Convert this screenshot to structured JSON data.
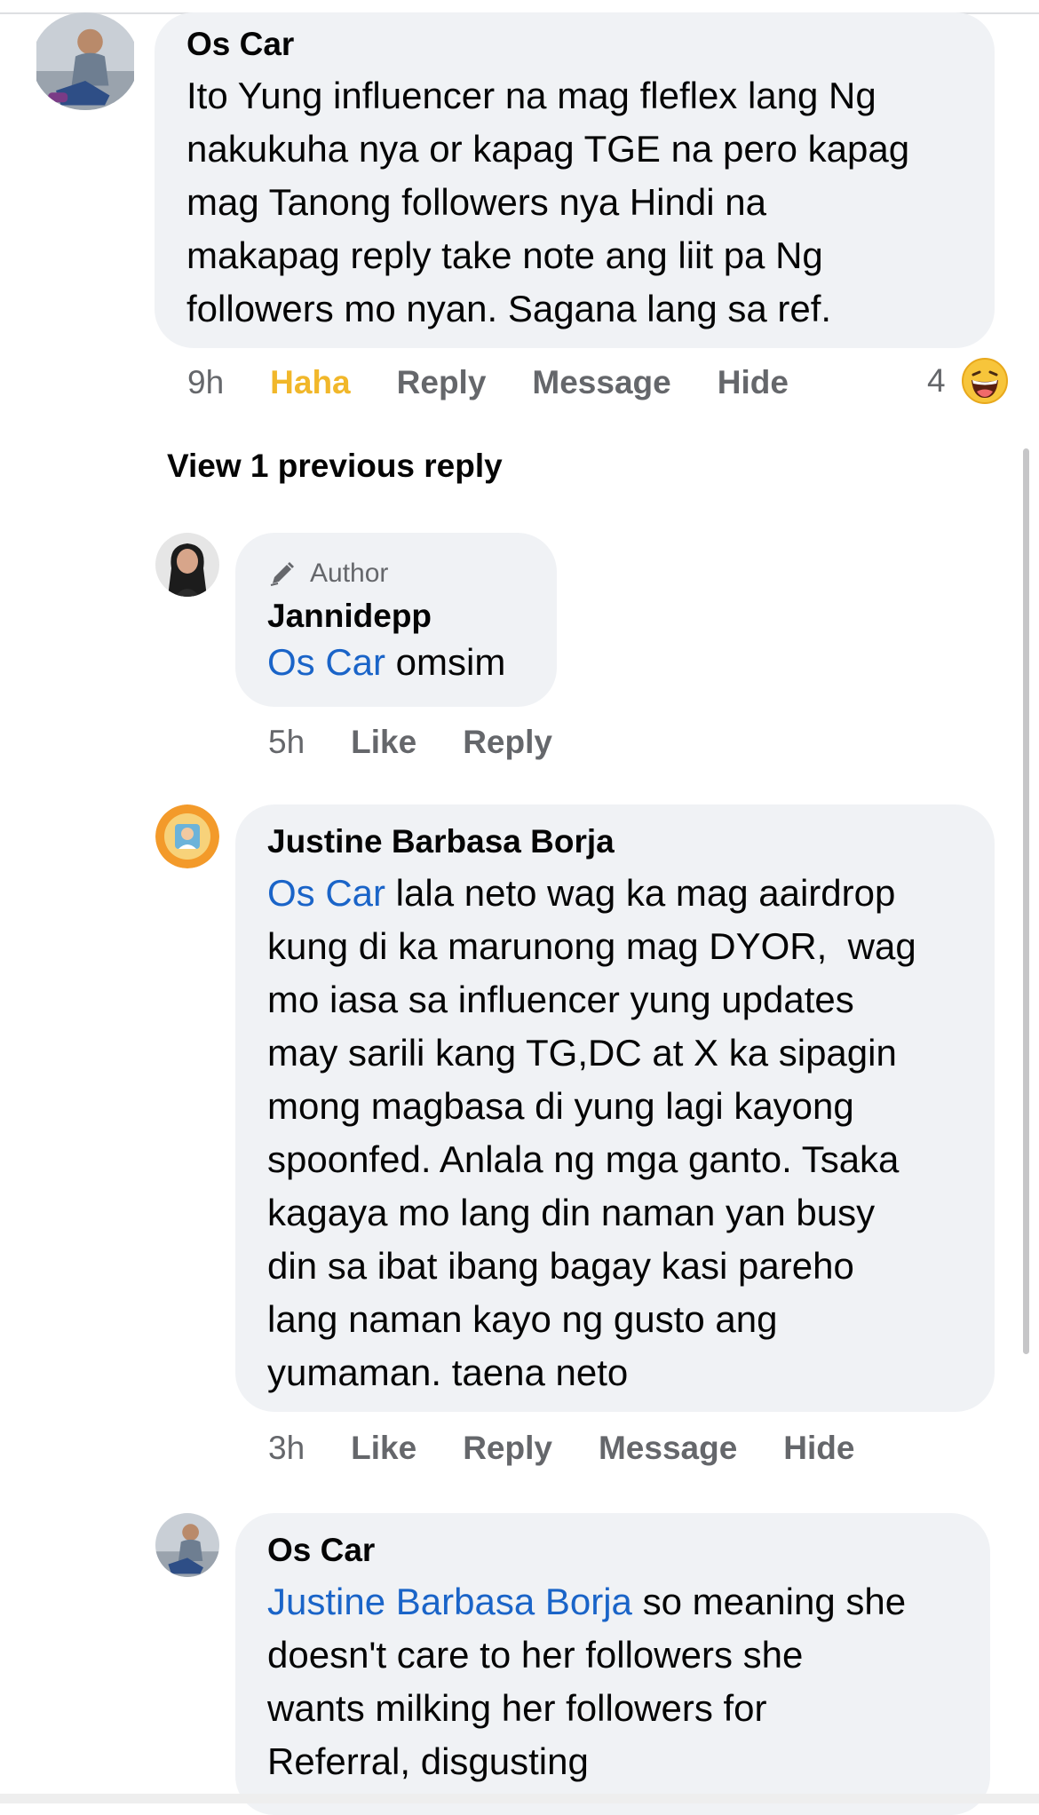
{
  "comments": [
    {
      "name": "Os Car",
      "lines": [
        "Ito Yung influencer na mag fleflex lang Ng",
        "nakukuha nya or kapag TGE na pero kapag",
        "mag Tanong followers nya Hindi na",
        "makapag reply take note ang liit pa Ng",
        "followers mo nyan. Sagana lang sa ref."
      ],
      "time": "9h",
      "actions": [
        "Haha",
        "Reply",
        "Message",
        "Hide"
      ],
      "reaction_count": "4",
      "reaction_icon": "laughing-emoji-icon"
    }
  ],
  "view_previous": "View 1 previous reply",
  "replies": [
    {
      "badge": "Author",
      "badge_icon": "pencil-icon",
      "name": "Jannidepp",
      "mention": "Os Car",
      "text": " omsim",
      "time": "5h",
      "actions": [
        "Like",
        "Reply"
      ]
    },
    {
      "name": "Justine Barbasa Borja",
      "mention": "Os Car",
      "first_line_rest": " lala neto wag ka mag aairdrop",
      "lines": [
        "kung di ka marunong mag DYOR,  wag",
        "mo iasa sa influencer yung updates",
        "may sarili kang TG,DC at X ka sipagin",
        "mong magbasa di yung lagi kayong",
        "spoonfed. Anlala ng mga ganto. Tsaka",
        "kagaya mo lang din naman yan busy",
        "din sa ibat ibang bagay kasi pareho",
        "lang naman kayo ng gusto ang",
        "yumaman. taena neto"
      ],
      "time": "3h",
      "actions": [
        "Like",
        "Reply",
        "Message",
        "Hide"
      ]
    },
    {
      "name": "Os Car",
      "mention": "Justine Barbasa Borja",
      "first_line_rest": " so meaning she",
      "lines": [
        "doesn't care to her followers she",
        "wants milking her followers for",
        "Referral, disgusting"
      ]
    }
  ],
  "colors": {
    "bubble": "#f0f2f5",
    "mention": "#1a64c8",
    "meta": "#65676b",
    "haha": "#f1b72a"
  }
}
